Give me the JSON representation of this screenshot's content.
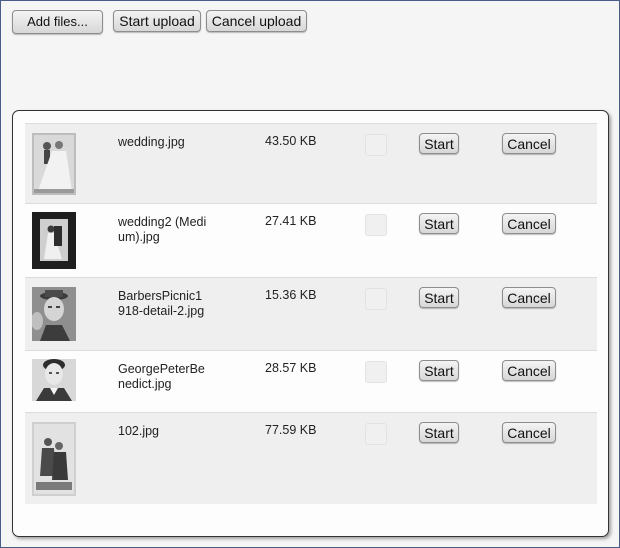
{
  "toolbar": {
    "add_files_label": "Add files...",
    "start_upload_label": "Start upload",
    "cancel_upload_label": "Cancel upload"
  },
  "files": [
    {
      "name": "wedding.jpg",
      "size": "43.50 KB",
      "start_label": "Start",
      "cancel_label": "Cancel"
    },
    {
      "name": "wedding2 (Medium).jpg",
      "size": "27.41 KB",
      "start_label": "Start",
      "cancel_label": "Cancel"
    },
    {
      "name": "BarbersPicnic1918-detail-2.jpg",
      "size": "15.36 KB",
      "start_label": "Start",
      "cancel_label": "Cancel"
    },
    {
      "name": "GeorgePeterBenedict.jpg",
      "size": "28.57 KB",
      "start_label": "Start",
      "cancel_label": "Cancel"
    },
    {
      "name": "102.jpg",
      "size": "77.59 KB",
      "start_label": "Start",
      "cancel_label": "Cancel"
    }
  ]
}
